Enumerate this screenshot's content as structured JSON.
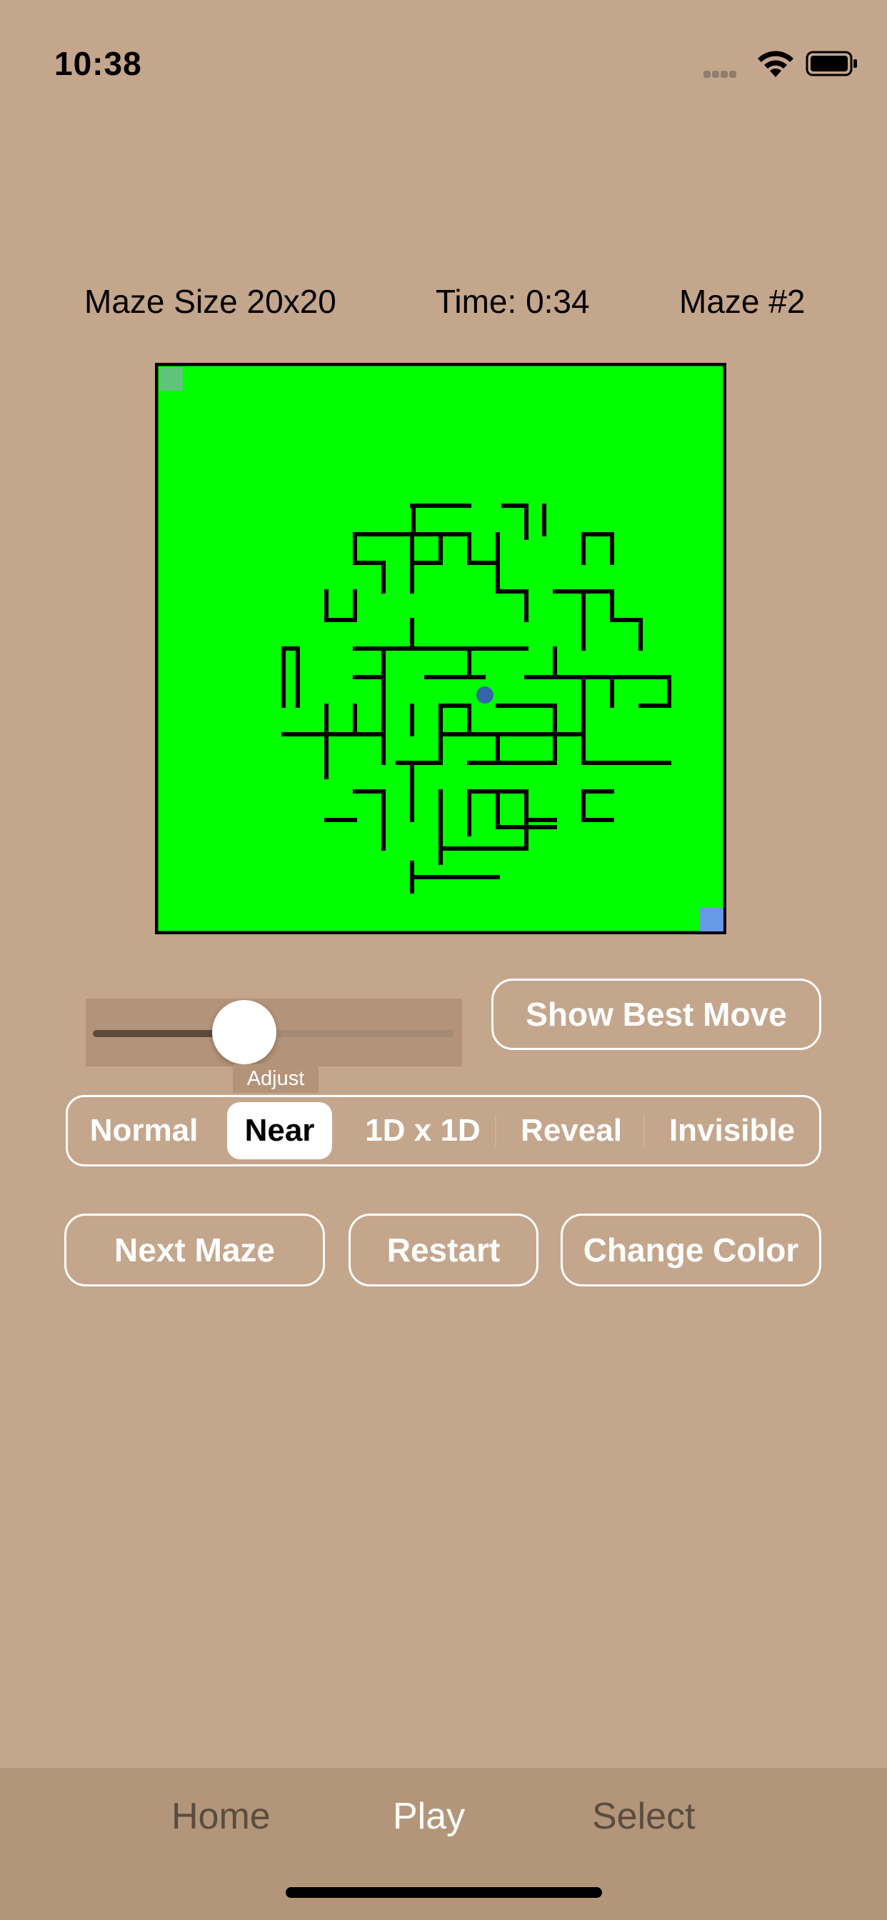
{
  "status": {
    "time": "10:38"
  },
  "info": {
    "maze_size": "Maze Size 20x20",
    "time": "Time: 0:34",
    "maze_number": "Maze #2"
  },
  "maze": {
    "background_color": "#00ff00",
    "wall_color": "#000000",
    "start_color": "#5ec47a",
    "end_color": "#6699e6",
    "player_color": "#3566a8"
  },
  "slider": {
    "label": "Adjust",
    "value": 0.42
  },
  "buttons": {
    "show_best_move": "Show Best Move",
    "next_maze": "Next Maze",
    "restart": "Restart",
    "change_color": "Change Color"
  },
  "modes": {
    "options": [
      "Normal",
      "Near",
      "1D x 1D",
      "Reveal",
      "Invisible"
    ],
    "selected": "Near"
  },
  "tabs": {
    "home": "Home",
    "play": "Play",
    "select": "Select",
    "active": "Play"
  }
}
